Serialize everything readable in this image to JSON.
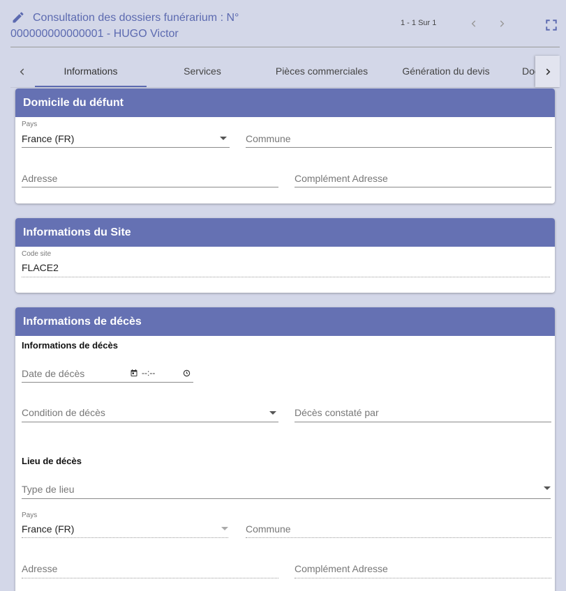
{
  "header": {
    "title": "Consultation des dossiers funérarium : N° 000000000000001 - HUGO Victor",
    "pager": "1 - 1 Sur 1"
  },
  "tabs": [
    {
      "label": "Informations"
    },
    {
      "label": "Services"
    },
    {
      "label": "Pièces commerciales"
    },
    {
      "label": "Génération du devis"
    },
    {
      "label": "Documents"
    }
  ],
  "domicile": {
    "title": "Domicile du défunt",
    "pays_label": "Pays",
    "pays_value": "France (FR)",
    "commune": "Commune",
    "adresse": "Adresse",
    "complement": "Complément Adresse"
  },
  "site": {
    "title": "Informations du Site",
    "code_label": "Code site",
    "code_value": "FLACE2"
  },
  "deces": {
    "title": "Informations de décès",
    "subtitle": "Informations de décès",
    "date": "Date de décès",
    "time": "--:--",
    "condition": "Condition de décès",
    "constate": "Décès constaté par",
    "lieu_title": "Lieu de décès",
    "type_lieu": "Type de lieu",
    "pays_label": "Pays",
    "pays_value": "France (FR)",
    "commune": "Commune",
    "adresse": "Adresse",
    "complement": "Complément Adresse"
  },
  "colors": {
    "accent": "#6571b3",
    "background": "#d3d7e8"
  },
  "icons": {
    "edit": "pencil-icon",
    "prev": "chevron-left-icon",
    "next": "chevron-right-icon",
    "fullscreen": "fullscreen-icon"
  }
}
